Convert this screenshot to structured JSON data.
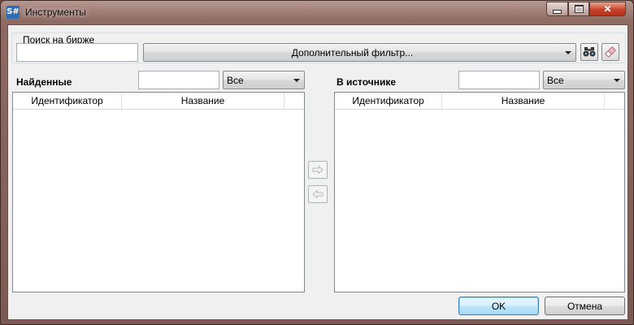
{
  "window": {
    "title": "Инструменты",
    "app_icon_text": "S#",
    "close_symbol": "✕"
  },
  "search": {
    "group_label": "Поиск на бирже",
    "query_value": "",
    "filter_combo_label": "Дополнительный фильтр...",
    "find_icon": "binoculars-icon",
    "clear_icon": "eraser-icon"
  },
  "found": {
    "label": "Найденные",
    "filter_value": "",
    "type_selected": "Все",
    "columns": [
      "Идентификатор",
      "Название"
    ],
    "rows": []
  },
  "source": {
    "label": "В источнике",
    "filter_value": "",
    "type_selected": "Все",
    "columns": [
      "Идентификатор",
      "Название"
    ],
    "rows": []
  },
  "transfer": {
    "add_icon": "arrow-right-icon",
    "remove_icon": "arrow-left-icon"
  },
  "footer": {
    "ok_label": "OK",
    "cancel_label": "Отмена"
  }
}
